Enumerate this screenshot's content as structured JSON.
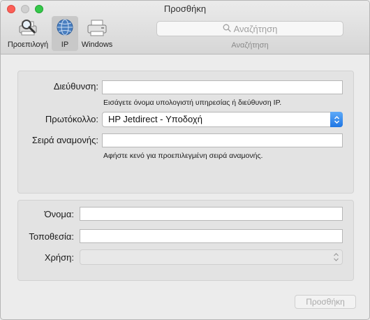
{
  "window": {
    "title": "Προσθήκη"
  },
  "toolbar": {
    "tabs": [
      {
        "label": "Προεπιλογή",
        "icon": "printer-magnifier-icon"
      },
      {
        "label": "IP",
        "icon": "globe-icon",
        "selected": true
      },
      {
        "label": "Windows",
        "icon": "windows-printer-icon"
      }
    ],
    "search": {
      "placeholder": "Αναζήτηση",
      "caption": "Αναζήτηση"
    }
  },
  "form": {
    "address": {
      "label": "Διεύθυνση:",
      "value": "",
      "hint": "Εισάγετε όνομα υπολογιστή υπηρεσίας ή διεύθυνση IP."
    },
    "protocol": {
      "label": "Πρωτόκολλο:",
      "value": "HP Jetdirect - Υποδοχή"
    },
    "queue": {
      "label": "Σειρά αναμονής:",
      "value": "",
      "hint": "Αφήστε κενό για προεπιλεγμένη σειρά αναμονής."
    },
    "name": {
      "label": "Όνομα:",
      "value": ""
    },
    "location": {
      "label": "Τοποθεσία:",
      "value": ""
    },
    "use": {
      "label": "Χρήση:",
      "value": ""
    }
  },
  "actions": {
    "add_label": "Προσθήκη"
  },
  "colors": {
    "accent": "#1f76e4"
  }
}
